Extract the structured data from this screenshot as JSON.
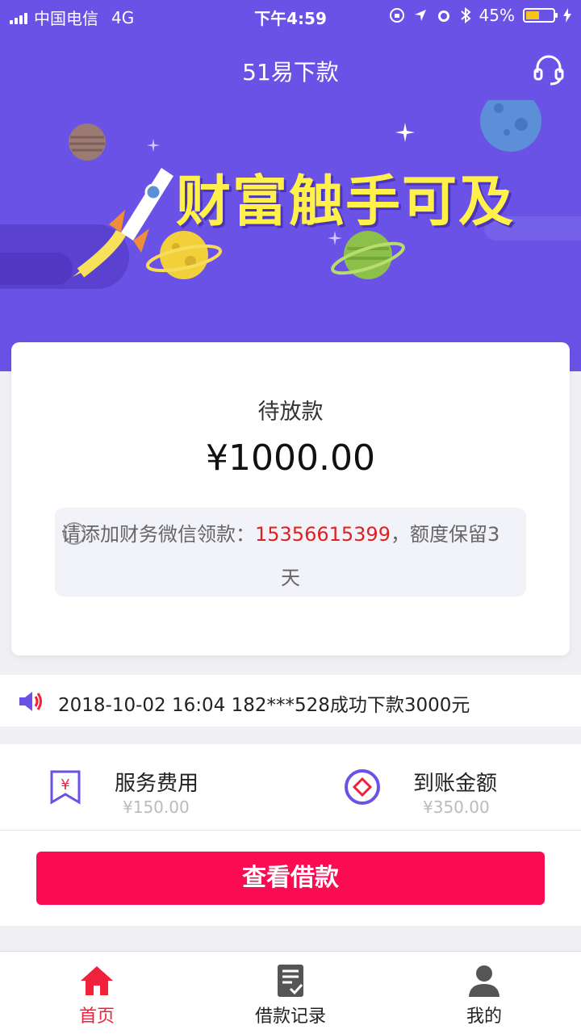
{
  "status_bar": {
    "carrier": "中国电信",
    "network": "4G",
    "time": "下午4:59",
    "battery": "45%"
  },
  "header": {
    "title": "51易下款",
    "headset_icon": "headset-icon"
  },
  "banner": {
    "text": "财富触手可及"
  },
  "card": {
    "label": "待放款",
    "amount": "¥1000.00",
    "notice_prefix": "请添加财务微信领款：",
    "notice_phone": "15356615399",
    "notice_suffix": "，额度保留3",
    "notice_line2": "天"
  },
  "marquee": {
    "text": "2018-10-02 16:04 182***528成功下款3000元"
  },
  "fees": {
    "service": {
      "title": "服务费用",
      "value": "¥150.00"
    },
    "arrival": {
      "title": "到账金额",
      "value": "¥350.00"
    }
  },
  "action_button": "查看借款",
  "tabs": [
    {
      "label": "首页",
      "icon": "home-icon",
      "active": true
    },
    {
      "label": "借款记录",
      "icon": "records-icon",
      "active": false
    },
    {
      "label": "我的",
      "icon": "user-icon",
      "active": false
    }
  ],
  "colors": {
    "header_bg": "#6a52e6",
    "accent_red": "#fa0c52",
    "phone_red": "#e02020",
    "banner_text": "#fff04a"
  }
}
